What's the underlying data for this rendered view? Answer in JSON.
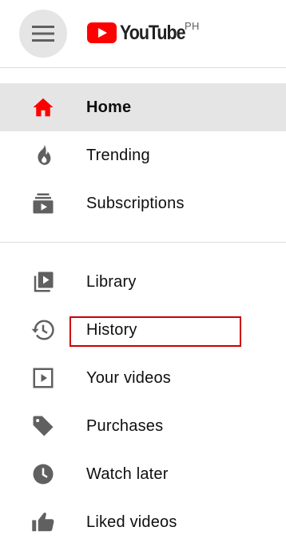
{
  "header": {
    "menu_icon": "hamburger-menu-icon",
    "logo_text": "YouTube",
    "country_code": "PH",
    "brand_color": "#ff0000"
  },
  "sections": {
    "primary": [
      {
        "label": "Home",
        "icon": "home-icon",
        "active": true,
        "icon_color": "#ff0000"
      },
      {
        "label": "Trending",
        "icon": "flame-icon",
        "active": false,
        "icon_color": "#606060"
      },
      {
        "label": "Subscriptions",
        "icon": "subscriptions-icon",
        "active": false,
        "icon_color": "#606060"
      }
    ],
    "library": [
      {
        "label": "Library",
        "icon": "library-icon",
        "active": false
      },
      {
        "label": "History",
        "icon": "history-icon",
        "active": false,
        "outlined": true,
        "outline_color": "#cc0000"
      },
      {
        "label": "Your videos",
        "icon": "play-square-icon",
        "active": false
      },
      {
        "label": "Purchases",
        "icon": "tag-icon",
        "active": false
      },
      {
        "label": "Watch later",
        "icon": "clock-icon",
        "active": false
      },
      {
        "label": "Liked videos",
        "icon": "thumbs-up-icon",
        "active": false
      }
    ]
  },
  "colors": {
    "active_background": "#e5e5e5",
    "icon_default": "#606060",
    "text": "#0f0f0f",
    "divider": "#dcdcdc"
  }
}
